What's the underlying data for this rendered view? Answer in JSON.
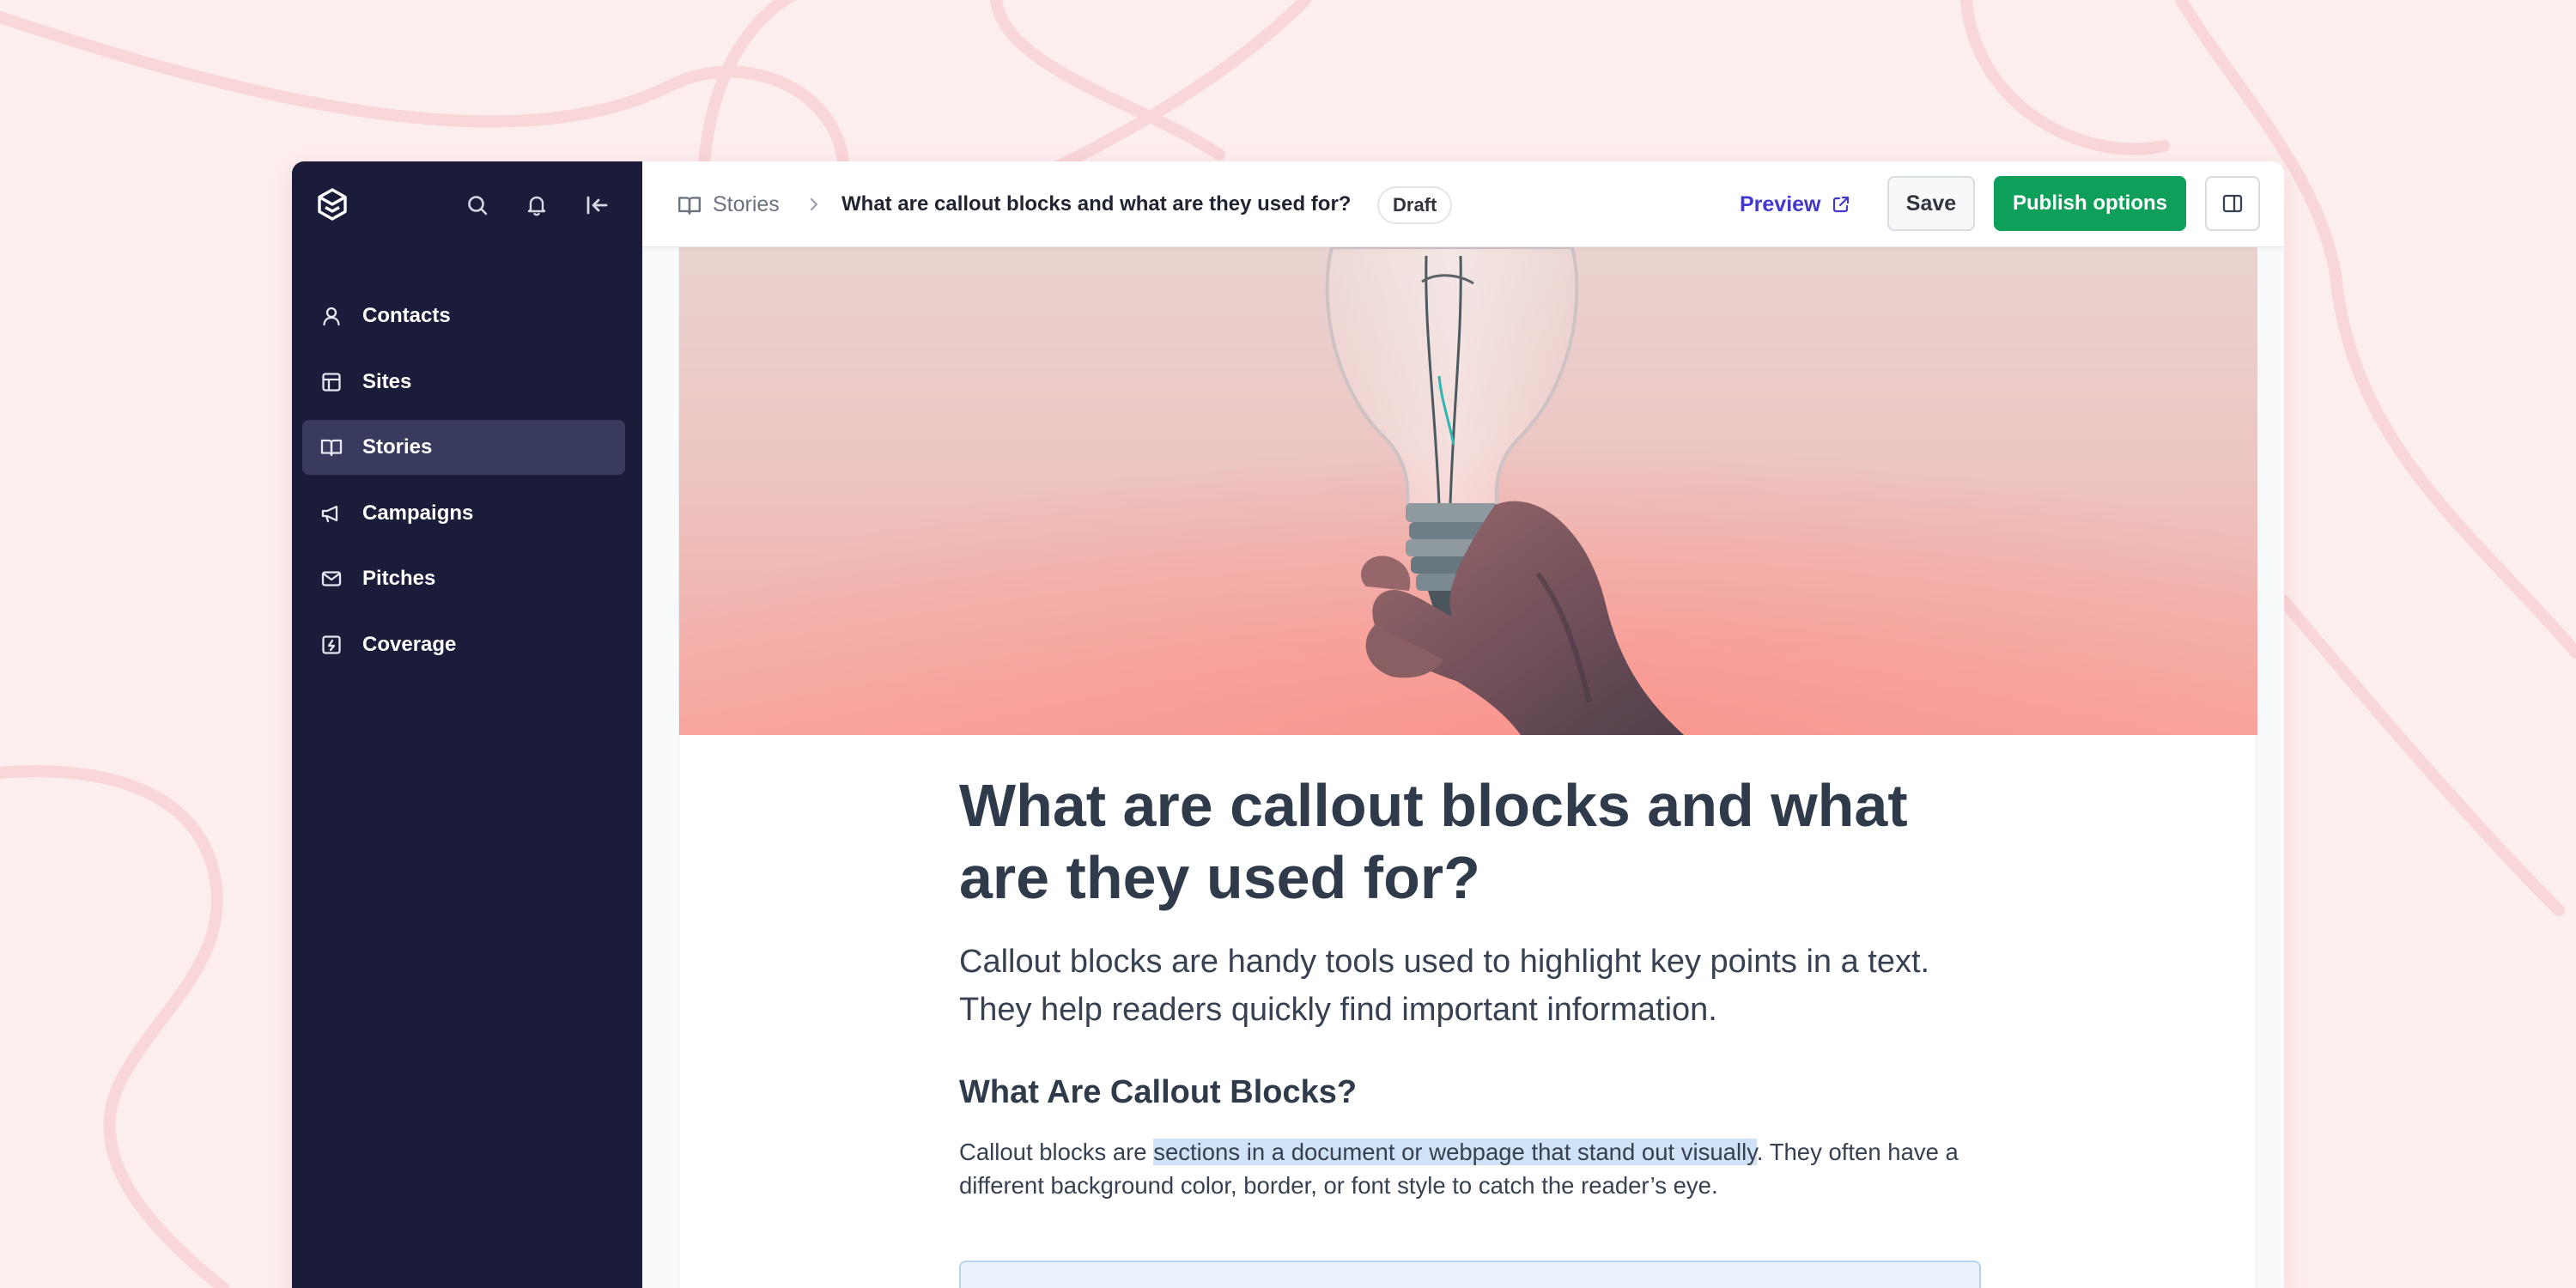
{
  "colors": {
    "background": "#fdeeee",
    "sidebar": "#1b1c3a",
    "sidebar_active": "#383a5e",
    "primary": "#0ea05a",
    "link": "#4338ca",
    "highlight": "#cfe2f7"
  },
  "sidebar": {
    "icons": [
      "logo-icon",
      "search-icon",
      "bell-icon",
      "collapse-sidebar-icon"
    ],
    "items": [
      {
        "label": "Contacts",
        "icon": "user-icon",
        "active": false
      },
      {
        "label": "Sites",
        "icon": "layout-icon",
        "active": false
      },
      {
        "label": "Stories",
        "icon": "book-open-icon",
        "active": true
      },
      {
        "label": "Campaigns",
        "icon": "megaphone-icon",
        "active": false
      },
      {
        "label": "Pitches",
        "icon": "mail-icon",
        "active": false
      },
      {
        "label": "Coverage",
        "icon": "coverage-icon",
        "active": false
      }
    ]
  },
  "topbar": {
    "breadcrumb_root": "Stories",
    "title": "What are callout blocks and what are they used for?",
    "status_badge": "Draft",
    "preview_label": "Preview",
    "save_label": "Save",
    "publish_label": "Publish options"
  },
  "article": {
    "title": "What are callout blocks and what are they used for?",
    "lead": "Callout blocks are handy tools used to highlight key points in a text. They help readers quickly find important information.",
    "heading": "What Are Callout Blocks?",
    "para_before": "Callout blocks are ",
    "para_highlight": "sections in a document or webpage that stand out visually",
    "para_after": ". They often have a different background color, border, or font style to catch the reader’s eye."
  }
}
